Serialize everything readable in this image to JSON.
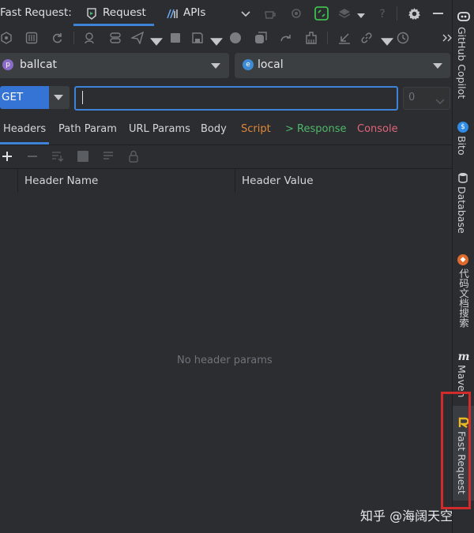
{
  "titlebar": {
    "app_label": "Fast Request:",
    "tab_request": "Request",
    "tab_apis": "APIs"
  },
  "toolbar": {
    "icons": [
      "module-icon",
      "sliders-icon",
      "refresh-icon",
      "user-search-icon",
      "capsule-icon",
      "send-icon",
      "send-dropdown-icon",
      "stop-icon",
      "save-icon",
      "save-dropdown-icon",
      "record-icon",
      "copy-icon",
      "redo-icon",
      "cleanup-icon",
      "import-icon",
      "link-icon",
      "link-dropdown-icon",
      "history-icon",
      "more-icon"
    ]
  },
  "project_select": {
    "badge": "p",
    "value": "ballcat"
  },
  "env_select": {
    "badge": "e",
    "value": "local"
  },
  "request": {
    "method": "GET",
    "url_value": "",
    "thread_count": "0"
  },
  "tabs": [
    {
      "label": "Headers",
      "color": "#d4d6da"
    },
    {
      "label": "Path Param",
      "color": "#d4d6da"
    },
    {
      "label": "URL Params",
      "color": "#d4d6da"
    },
    {
      "label": "Body",
      "color": "#d4d6da"
    },
    {
      "label": "Script",
      "color": "#e0883a"
    },
    {
      "label": "> Response",
      "color": "#4fb86a"
    },
    {
      "label": "Console",
      "color": "#e2657a"
    }
  ],
  "table": {
    "columns": [
      "Header Name",
      "Header Value"
    ],
    "empty_text": "No header params"
  },
  "right_sidebar": {
    "items": [
      {
        "label": "GitHub Copilot",
        "icon": "copilot-icon"
      },
      {
        "label": "Bito",
        "icon": "bito-icon"
      },
      {
        "label": "Database",
        "icon": "database-icon"
      },
      {
        "label": "代码文档搜索",
        "icon": "doc-search-icon"
      },
      {
        "label": "Maven",
        "icon": "maven-icon"
      },
      {
        "label": "Fast Request",
        "icon": "fast-request-icon"
      }
    ]
  },
  "watermark": "知乎 @海阔天空",
  "colors": {
    "accent": "#3d84d8",
    "highlight": "#d12b2b",
    "background": "#2b2d30"
  }
}
